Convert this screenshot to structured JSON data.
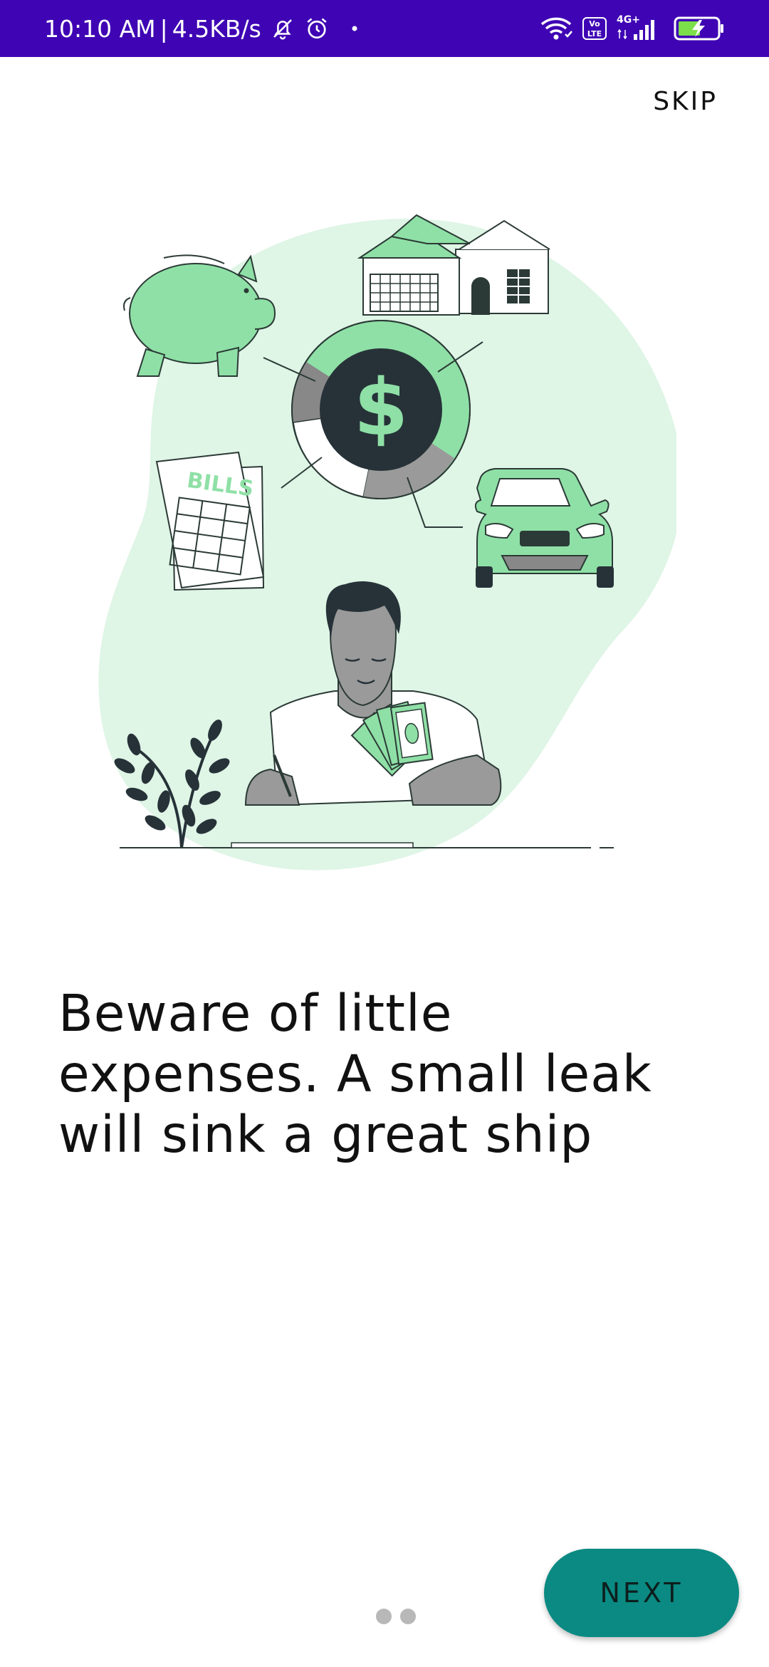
{
  "status_bar": {
    "time": "10:10 AM",
    "separator": "|",
    "net_speed": "4.5KB/s",
    "network_type": "4G+",
    "volte_label": "Vo LTE",
    "background_color": "#3f05b4",
    "icons": [
      "mute-icon",
      "alarm-icon",
      "dot-icon",
      "wifi-icon",
      "volte-icon",
      "signal-icon",
      "battery-charging-icon"
    ]
  },
  "onboarding": {
    "skip_label": "SKIP",
    "illustration": {
      "bills_label": "BILLS",
      "currency_symbol": "$"
    },
    "headline": "Beware of little expenses. A small leak will sink a great ship",
    "pager": {
      "total_pages": 2,
      "current_page": 1
    },
    "next_label": "NEXT",
    "accent_color": "#0a8a82",
    "illustration_green": "#8fe0a6"
  }
}
